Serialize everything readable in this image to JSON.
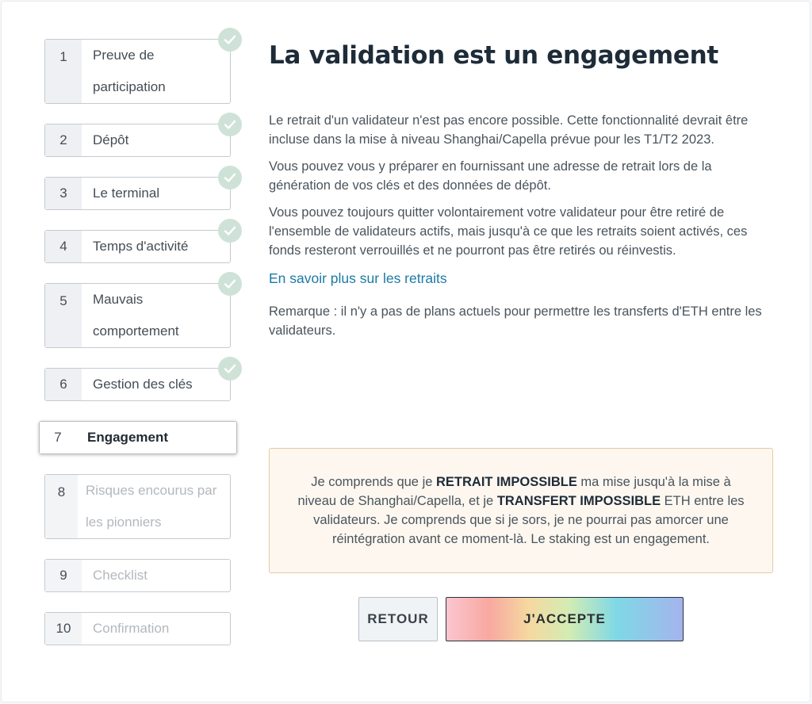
{
  "steps": [
    {
      "num": "1",
      "label": "Preuve de participation",
      "line1": "Preuve de",
      "line2": "participation",
      "state": "done"
    },
    {
      "num": "2",
      "label": "Dépôt",
      "state": "done"
    },
    {
      "num": "3",
      "label": "Le terminal",
      "state": "done"
    },
    {
      "num": "4",
      "label": "Temps d'activité",
      "state": "done"
    },
    {
      "num": "5",
      "label": "Mauvais comportement",
      "line1": "Mauvais",
      "line2": "comportement",
      "state": "done"
    },
    {
      "num": "6",
      "label": "Gestion des clés",
      "state": "done"
    },
    {
      "num": "7",
      "label": "Engagement",
      "state": "active"
    },
    {
      "num": "8",
      "label": "Risques encourus par les pionniers",
      "line1": "Risques encourus par",
      "line2": "les pionniers",
      "state": "disabled"
    },
    {
      "num": "9",
      "label": "Checklist",
      "state": "disabled"
    },
    {
      "num": "10",
      "label": "Confirmation",
      "state": "disabled"
    }
  ],
  "main": {
    "title": "La validation est un engagement",
    "paragraphs": [
      "Le retrait d'un validateur n'est pas encore possible. Cette fonctionnalité devrait être incluse dans la mise à niveau Shanghai/Capella prévue pour les T1/T2 2023.",
      "Vous pouvez vous y préparer en fournissant une adresse de retrait lors de la génération de vos clés et des données de dépôt.",
      "Vous pouvez toujours quitter volontairement votre validateur pour être retiré de l'ensemble de validateurs actifs, mais jusqu'à ce que les retraits soient activés, ces fonds resteront verrouillés et ne pourront pas être retirés ou réinvestis."
    ],
    "link": "En savoir plus sur les retraits",
    "remark": "Remarque : il n'y a pas de plans actuels pour permettre les transferts d'ETH entre les validateurs."
  },
  "notice": {
    "t1": "Je comprends que je ",
    "b1": "RETRAIT IMPOSSIBLE",
    "t2": " ma mise jusqu'à la mise à niveau de Shanghai/Capella, et je ",
    "b2": "TRANSFERT IMPOSSIBLE",
    "t3": " ETH entre les validateurs. Je comprends que si je sors, je ne pourrai pas amorcer une réintégration avant ce moment-là. Le staking est un engagement."
  },
  "buttons": {
    "back": "RETOUR",
    "accept": "J'ACCEPTE"
  },
  "colors": {
    "check_bg": "#cfe2d7",
    "link": "#1c7aa3",
    "notice_bg": "#fdf7f0",
    "notice_border": "#e6c9a0"
  },
  "icons": {
    "step_done": "checkmark-icon"
  }
}
